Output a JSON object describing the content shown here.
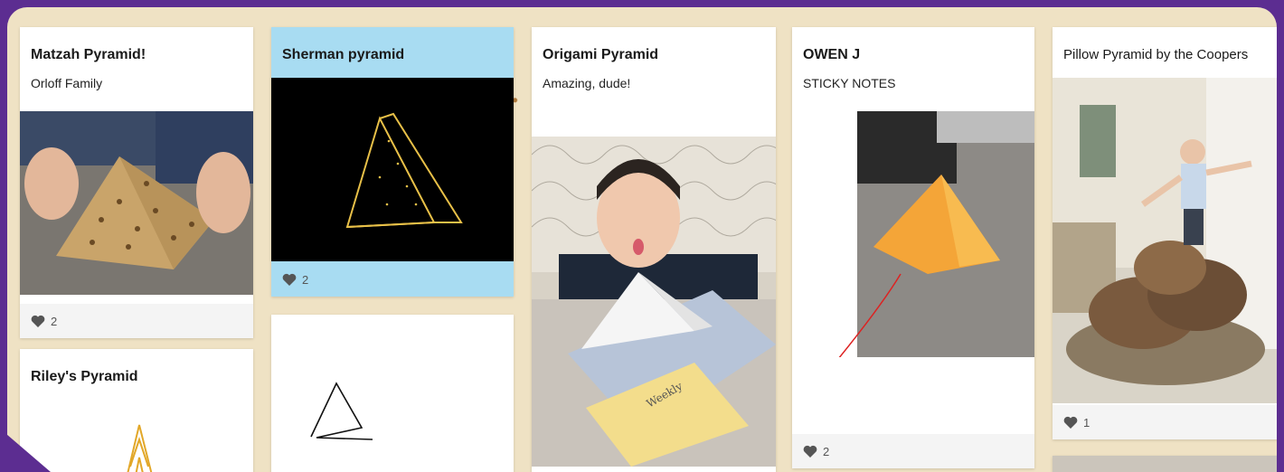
{
  "cards": {
    "matzah": {
      "title": "Matzah Pyramid!",
      "subtitle": "Orloff Family",
      "likes": "2"
    },
    "sherman": {
      "title": "Sherman pyramid",
      "likes": "2"
    },
    "origami": {
      "title": "Origami Pyramid",
      "subtitle": "Amazing, dude!"
    },
    "owen": {
      "title": "OWEN J",
      "subtitle": "STICKY NOTES",
      "likes": "2"
    },
    "pillow": {
      "title": "Pillow Pyramid by the Coopers",
      "likes": "1"
    },
    "riley": {
      "title": "Riley's Pyramid"
    }
  },
  "colors": {
    "frame": "#5c2d91",
    "sherman_accent": "#a8dcf2",
    "heart": "#555555"
  },
  "icons": {
    "like": "heart-icon"
  }
}
